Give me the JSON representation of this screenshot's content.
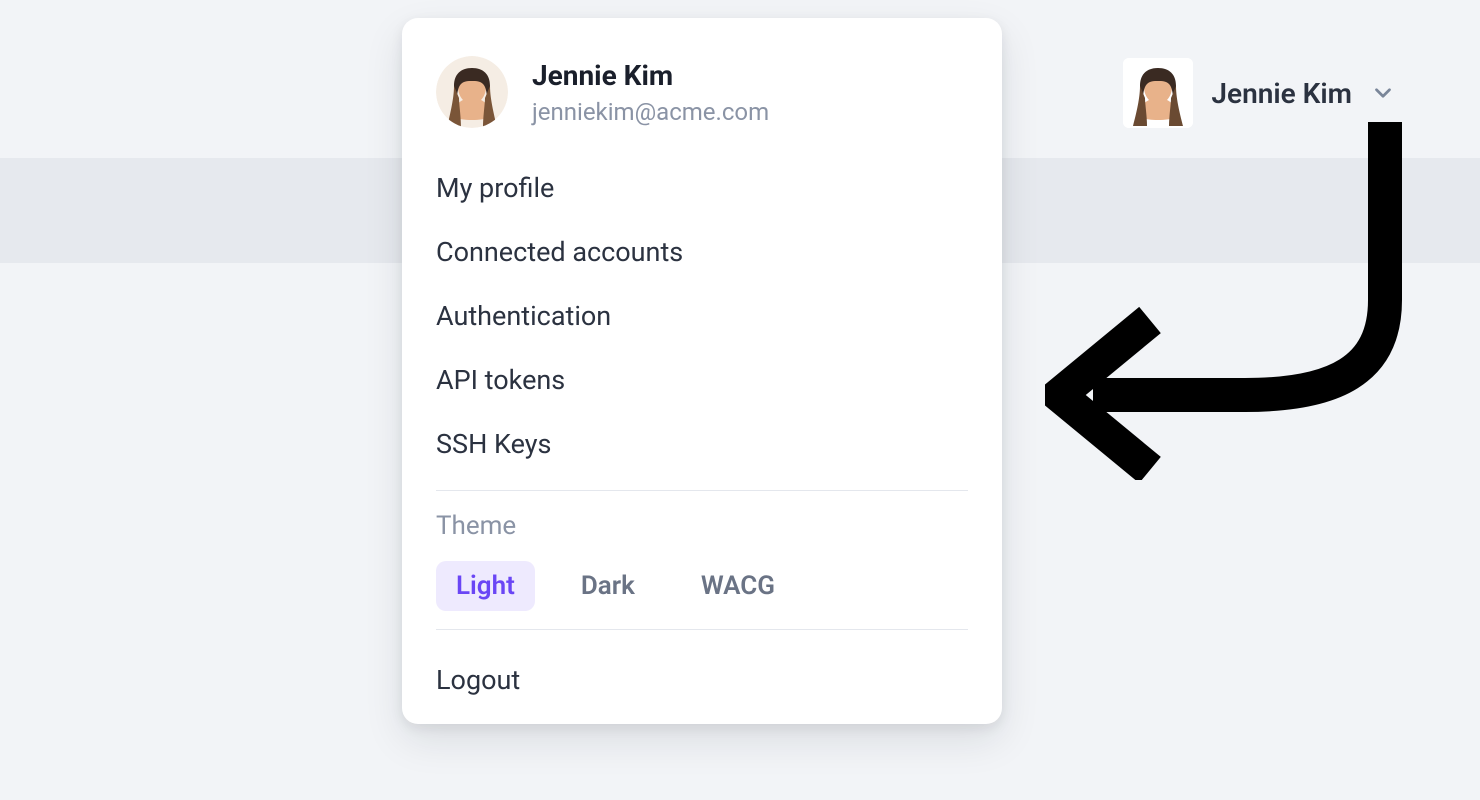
{
  "header": {
    "username": "Jennie Kim",
    "avatar_alt": "user-avatar"
  },
  "dropdown": {
    "user": {
      "name": "Jennie Kim",
      "email": "jenniekim@acme.com"
    },
    "menu_items": [
      {
        "label": "My profile"
      },
      {
        "label": "Connected accounts"
      },
      {
        "label": "Authentication"
      },
      {
        "label": "API tokens"
      },
      {
        "label": "SSH Keys"
      }
    ],
    "theme": {
      "label": "Theme",
      "options": [
        {
          "label": "Light",
          "active": true
        },
        {
          "label": "Dark",
          "active": false
        },
        {
          "label": "WACG",
          "active": false
        }
      ]
    },
    "logout_label": "Logout"
  },
  "colors": {
    "accent": "#6a46f5",
    "accent_bg": "#eeeafe",
    "text_primary": "#2b3240",
    "text_muted": "#8a93a5",
    "page_bg": "#f2f4f7",
    "band_bg": "#e6e9ee"
  }
}
